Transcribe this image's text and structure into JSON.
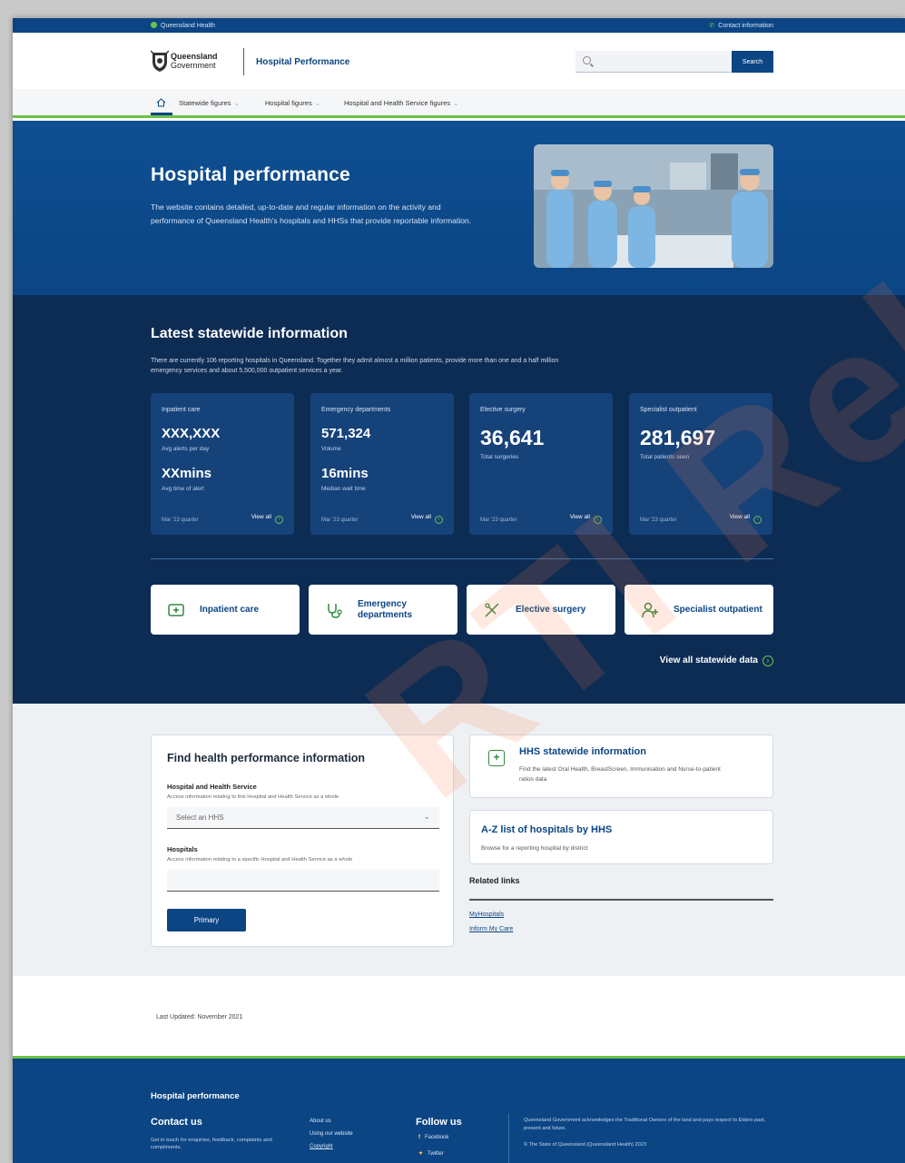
{
  "topbar": {
    "left": "Queensland Health",
    "right": "Contact information"
  },
  "header": {
    "gov_line1": "Queensland",
    "gov_line2": "Government",
    "site_name": "Hospital Performance",
    "search_placeholder": "",
    "search_button": "Search"
  },
  "nav": {
    "items": [
      {
        "label": "Statewide figures"
      },
      {
        "label": "Hospital figures"
      },
      {
        "label": "Hospital and Health Service figures"
      }
    ]
  },
  "hero": {
    "title": "Hospital performance",
    "text": "The website contains detailed, up-to-date and regular information on the activity and performance of Queensland Health's hospitals and HHSs that provide reportable information."
  },
  "statewide": {
    "title": "Latest statewide information",
    "desc": "There are currently 106 reporting hospitals in Queensland. Together they admit almost a million patients, provide more than one and a half million emergency services and about 5,500,000 outpatient services a year.",
    "cards": [
      {
        "title": "Inpatient care",
        "v1": "XXX,XXX",
        "l1": "Avg alerts per day",
        "v2": "XXmins",
        "l2": "Avg time of alert",
        "quarter": "Mar '23 quarter",
        "view": "View all"
      },
      {
        "title": "Emergency departments",
        "v1": "571,324",
        "l1": "Volume",
        "v2": "16mins",
        "l2": "Median wait time",
        "quarter": "Mar '23 quarter",
        "view": "View all"
      },
      {
        "title": "Elective surgery",
        "v1": "36,641",
        "l1": "Total surgeries",
        "quarter": "Mar '23 quarter",
        "view": "View all"
      },
      {
        "title": "Specialist outpatient",
        "v1": "281,697",
        "l1": "Total patients seen",
        "quarter": "Mar '23 quarter",
        "view": "View all"
      }
    ],
    "tiles": [
      {
        "label": "Inpatient care"
      },
      {
        "label": "Emergency departments"
      },
      {
        "label": "Elective surgery"
      },
      {
        "label": "Specialist outpatient"
      }
    ],
    "view_all": "View all statewide data"
  },
  "find": {
    "title": "Find health performance information",
    "hhs_label": "Hospital and Health Service",
    "hhs_help": "Access information relating to this Hospital and Health Service as a whole",
    "hhs_select": "Select an HHS",
    "hosp_label": "Hospitals",
    "hosp_help": "Access information relating to a specific Hospital and Health Service as a whole",
    "hosp_value": "",
    "primary": "Primary"
  },
  "right": {
    "hhs_title": "HHS statewide information",
    "hhs_desc": "Find the latest Oral Health, BreastScreen, Immunisation and Nurse-to-patient ratios data",
    "az_title": "A-Z list of hospitals by HHS",
    "az_desc": "Browse for a reporting hospital by district",
    "related": "Related links",
    "links": [
      "MyHospitals",
      "Inform My Care"
    ]
  },
  "updated": "Last Updated: November 2021",
  "footer": {
    "title": "Hospital performance",
    "contact": "Contact us",
    "contact_desc": "Get in touch for enquiries, feedback, complaints and compliments.",
    "links": [
      "About us",
      "Using our website",
      "Copyright"
    ],
    "follow": "Follow us",
    "social": [
      "Facebook",
      "Twitter"
    ],
    "ack": "Queensland Government acknowledges the Traditional Owners of the land and pays respect to Elders past, present and future.",
    "copyright": "© The State of Queensland (Queensland Health) 2023"
  },
  "watermark": "RTI Release",
  "colors": {
    "brand": "#0b4584",
    "navy": "#0d2c54",
    "accent": "#6cc24a"
  }
}
